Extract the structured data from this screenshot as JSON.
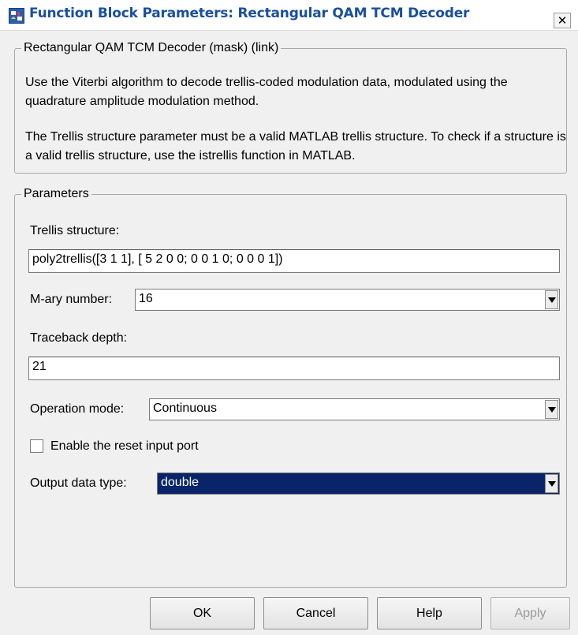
{
  "window": {
    "title": "Function Block Parameters: Rectangular QAM TCM Decoder",
    "close_glyph": "✕",
    "app_icon": "simulink-block-icon"
  },
  "description": {
    "group_title": "Rectangular QAM TCM Decoder (mask) (link)",
    "paragraph_1": "Use the Viterbi algorithm to decode trellis-coded modulation data, modulated using the quadrature amplitude modulation method.",
    "paragraph_2": "The Trellis structure parameter must be a valid MATLAB trellis structure. To check if a structure is a valid trellis structure, use the istrellis function in MATLAB."
  },
  "parameters": {
    "group_title": "Parameters",
    "trellis_structure": {
      "label": "Trellis structure:",
      "value": "poly2trellis([3 1 1], [ 5 2 0 0; 0 0 1 0; 0 0 0 1])"
    },
    "mary_number": {
      "label": "M-ary number:",
      "value": "16"
    },
    "traceback_depth": {
      "label": "Traceback depth:",
      "value": "21"
    },
    "operation_mode": {
      "label": "Operation mode:",
      "value": "Continuous"
    },
    "reset_port": {
      "label": "Enable the reset input port",
      "checked": false
    },
    "output_data_type": {
      "label": "Output data type:",
      "value": "double"
    }
  },
  "buttons": {
    "ok": "OK",
    "cancel": "Cancel",
    "help": "Help",
    "apply": "Apply"
  },
  "colors": {
    "title_text": "#1a4fa0",
    "selection_bg": "#0a246a",
    "window_bg": "#f0f0f0"
  }
}
